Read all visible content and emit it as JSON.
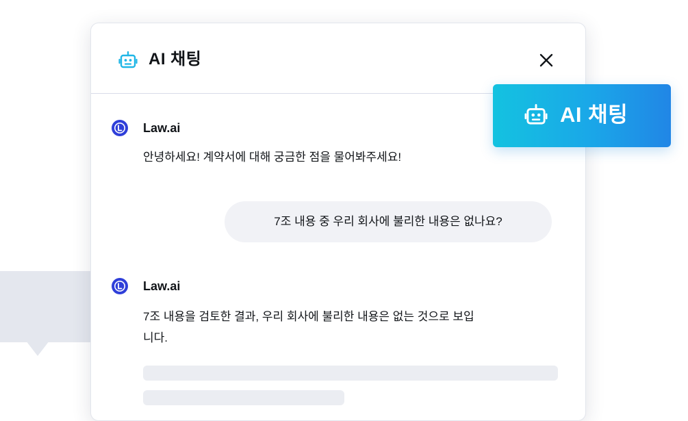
{
  "header": {
    "title": "AI 채팅",
    "icon": "robot-icon",
    "close_icon": "close-icon"
  },
  "messages": [
    {
      "role": "assistant",
      "sender": "Law.ai",
      "text": "안녕하세요! 계약서에 대해 궁금한 점을 물어봐주세요!"
    },
    {
      "role": "user",
      "text": "7조 내용 중 우리 회사에 불리한 내용은 없나요?"
    },
    {
      "role": "assistant",
      "sender": "Law.ai",
      "text_line1": "7조 내용을 검토한 결과, 우리 회사에 불리한 내용은 없는 것으로 보입",
      "text_line2": "니다."
    }
  ],
  "cta": {
    "label": "AI 채팅",
    "icon": "robot-icon"
  },
  "colors": {
    "avatar": "#2f3fd9",
    "robot_icon": "#1fb6e6",
    "cta_gradient_start": "#14c2e0",
    "cta_gradient_end": "#2186e6",
    "user_bubble": "#f1f2f6",
    "skeleton": "#ebedf2"
  }
}
